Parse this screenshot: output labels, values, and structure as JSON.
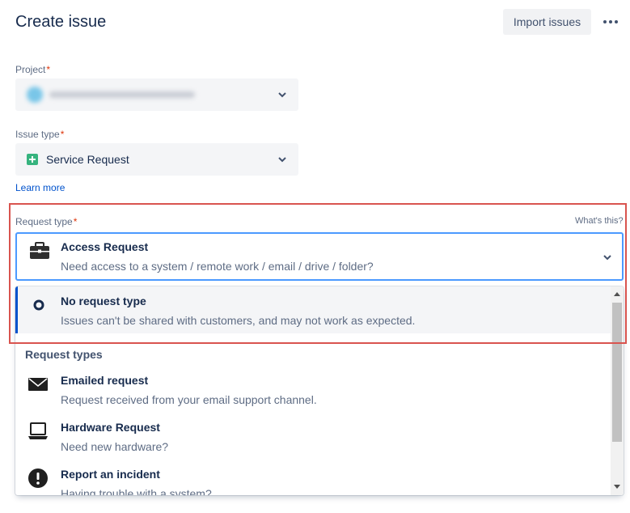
{
  "header": {
    "title": "Create issue",
    "import_label": "Import issues"
  },
  "project": {
    "label": "Project",
    "required_mark": "*"
  },
  "issue_type": {
    "label": "Issue type",
    "required_mark": "*",
    "value": "Service Request",
    "icon": "service-request-icon",
    "learn_more": "Learn more"
  },
  "request_type": {
    "label": "Request type",
    "required_mark": "*",
    "whats_this": "What's this?",
    "selected": {
      "title": "Access Request",
      "desc": "Need access to a system / remote work / email / drive / folder?",
      "icon": "briefcase-icon"
    }
  },
  "menu": {
    "none_option": {
      "title": "No request type",
      "desc": "Issues can't be shared with customers, and may not work as expected."
    },
    "group_label": "Request types",
    "options": [
      {
        "title": "Emailed request",
        "desc": "Request received from your email support channel.",
        "icon": "envelope-icon"
      },
      {
        "title": "Hardware Request",
        "desc": "Need new hardware?",
        "icon": "laptop-icon"
      },
      {
        "title": "Report an incident",
        "desc": "Having trouble with a system?",
        "icon": "exclamation-icon"
      }
    ]
  },
  "colors": {
    "accent": "#0052cc",
    "focus_border": "#4c9aff",
    "required": "#de350b",
    "highlight": "#d9544f"
  }
}
